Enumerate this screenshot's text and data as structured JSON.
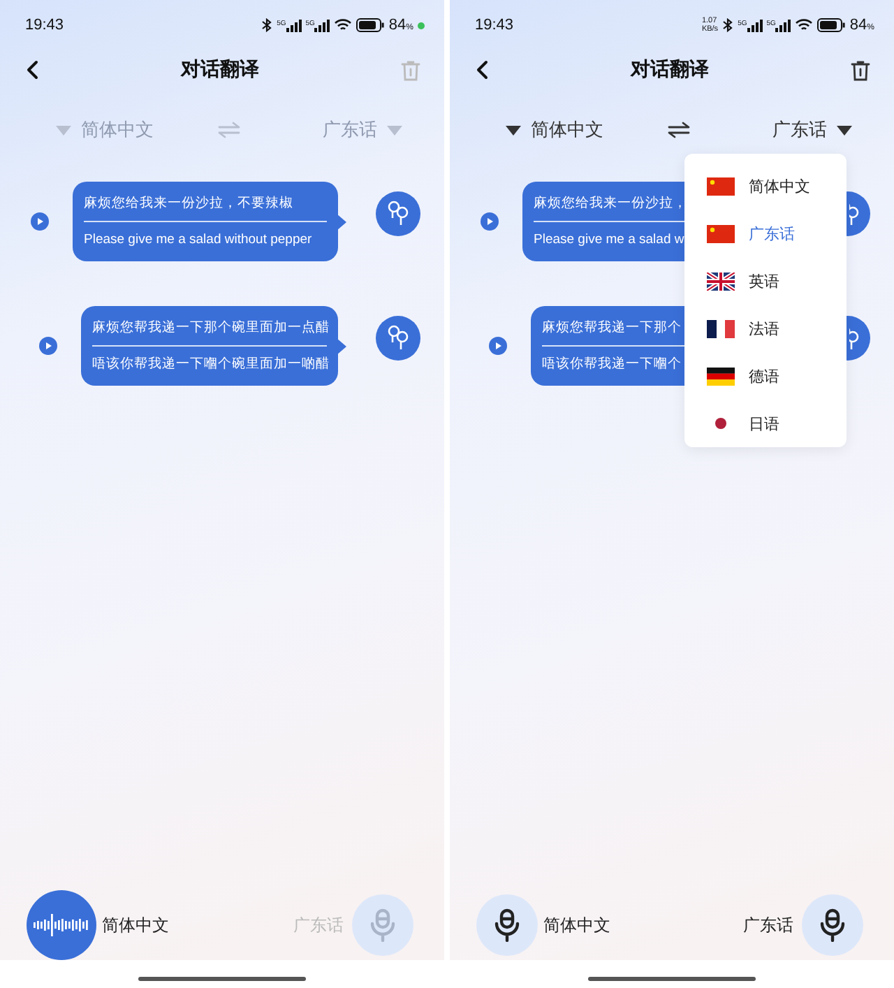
{
  "screens": [
    {
      "status_bar": {
        "time": "19:43",
        "signals": [
          "5G",
          "5G"
        ],
        "battery": "84",
        "battery_unit": "%",
        "privacy_dot": true
      },
      "header": {
        "title": "对话翻译",
        "delete_enabled": false
      },
      "languages": {
        "source": "简体中文",
        "target": "广东话",
        "enabled": false
      },
      "messages": [
        {
          "source": "麻烦您给我来一份沙拉，不要辣椒",
          "translation": "Please give me a salad without pepper"
        },
        {
          "source": "麻烦您帮我递一下那个碗里面加一点醋",
          "translation": "唔该你帮我递一下嗰个碗里面加一啲醋"
        }
      ],
      "mics": [
        {
          "label": "简体中文",
          "recording": true,
          "dimmed": false
        },
        {
          "label": "广东话",
          "recording": false,
          "dimmed": true
        }
      ]
    },
    {
      "status_bar": {
        "time": "19:43",
        "net_speed": [
          "1.07",
          "KB/s"
        ],
        "signals": [
          "5G",
          "5G"
        ],
        "battery": "84",
        "battery_unit": "%"
      },
      "header": {
        "title": "对话翻译",
        "delete_enabled": true
      },
      "languages": {
        "source": "简体中文",
        "target": "广东话",
        "enabled": true
      },
      "messages": [
        {
          "source": "麻烦您给我来一份沙拉，",
          "translation": "Please give me a salad w"
        },
        {
          "source": "麻烦您帮我递一下那个",
          "translation": "唔该你帮我递一下嗰个"
        }
      ],
      "dropdown": [
        {
          "label": "简体中文",
          "kind": "cn",
          "selected": false
        },
        {
          "label": "广东话",
          "kind": "cn",
          "selected": true
        },
        {
          "label": "英语",
          "kind": "gb",
          "selected": false
        },
        {
          "label": "法语",
          "kind": "fr",
          "selected": false
        },
        {
          "label": "德语",
          "kind": "de",
          "selected": false
        },
        {
          "label": "日语",
          "kind": "jp",
          "selected": false
        }
      ],
      "mics": [
        {
          "label": "简体中文",
          "recording": false,
          "dimmed": false
        },
        {
          "label": "广东话",
          "recording": false,
          "dimmed": false
        }
      ]
    }
  ]
}
